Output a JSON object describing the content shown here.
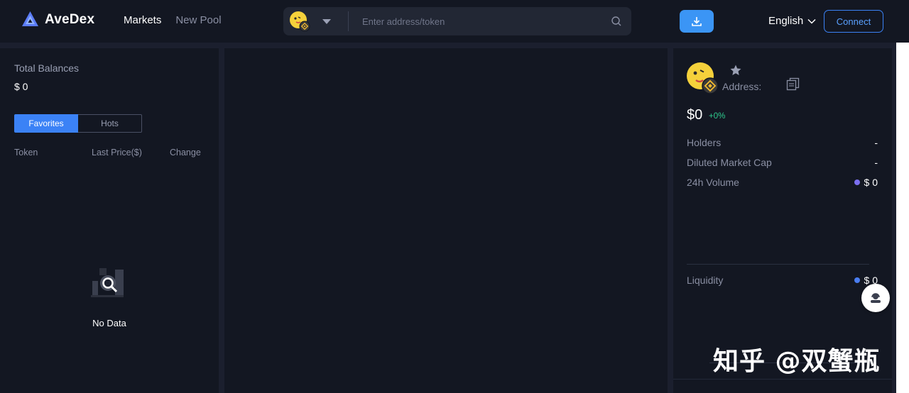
{
  "brand": {
    "name": "AveDex",
    "logo_icon": "avedex-logo-icon"
  },
  "nav": {
    "markets": "Markets",
    "new_pool": "New Pool"
  },
  "search": {
    "placeholder": "Enter address/token",
    "chain_icon": "bnb-chain-icon"
  },
  "header": {
    "download_icon": "download-icon",
    "language": "English",
    "connect_label": "Connect"
  },
  "left_panel": {
    "total_balances_label": "Total Balances",
    "total_balances_value": "$ 0",
    "tabs": [
      "Favorites",
      "Hots"
    ],
    "active_tab": "Favorites",
    "columns": [
      "Token",
      "Last Price($)",
      "Change"
    ],
    "empty_text": "No Data"
  },
  "token": {
    "address_label": "Address:",
    "price": "$0",
    "change": "+0%",
    "stats": [
      {
        "label": "Holders",
        "value": "-"
      },
      {
        "label": "Diluted Market Cap",
        "value": "-"
      },
      {
        "label": "24h Volume",
        "value": "$ 0",
        "dot_color": "#7b6ff0"
      }
    ],
    "liquidity": {
      "label": "Liquidity",
      "value": "$ 0",
      "dot_color": "#4a7df0"
    }
  },
  "watermark": "知乎 @双蟹瓶",
  "colors": {
    "accent": "#3b82f6",
    "positive": "#2ecc8f",
    "bg": "#1b1f2e",
    "panel": "#131722"
  }
}
